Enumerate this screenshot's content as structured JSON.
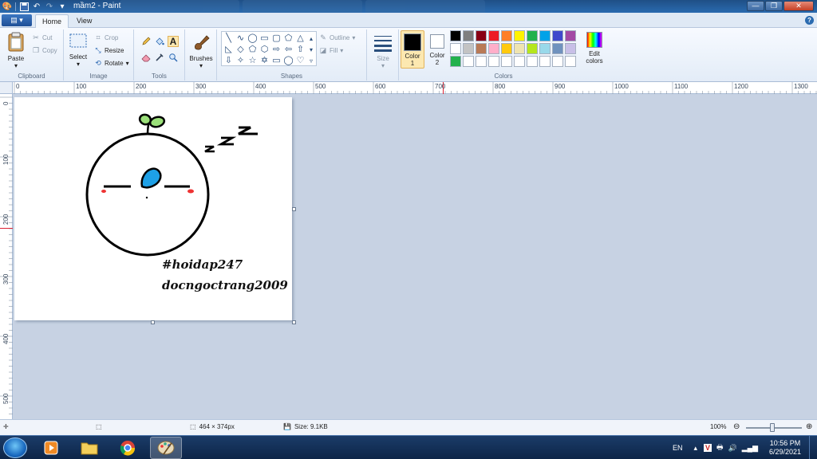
{
  "window": {
    "title": "mầm2 - Paint",
    "minimize": "—",
    "maximize": "❐",
    "close": "✕"
  },
  "ribbon_tabs": {
    "file": "▤ ▾",
    "home": "Home",
    "view": "View",
    "help": "?"
  },
  "clipboard": {
    "paste": "Paste",
    "cut": "Cut",
    "copy": "Copy",
    "label": "Clipboard"
  },
  "image": {
    "select": "Select",
    "crop": "Crop",
    "resize": "Resize",
    "rotate": "Rotate",
    "label": "Image"
  },
  "tools": {
    "label": "Tools"
  },
  "brushes": {
    "label": "Brushes"
  },
  "shapes": {
    "outline": "Outline",
    "fill": "Fill",
    "label": "Shapes"
  },
  "size": {
    "label": "Size"
  },
  "colors": {
    "color1_label": "Color 1",
    "color2_label": "Color 2",
    "color1_value": "#000000",
    "color2_value": "#ffffff",
    "edit_colors": "Edit colors",
    "label": "Colors",
    "palette": [
      "#000000",
      "#7f7f7f",
      "#880015",
      "#ed1c24",
      "#ff7f27",
      "#fff200",
      "#22b14c",
      "#00a2e8",
      "#3f48cc",
      "#a349a4",
      "#ffffff",
      "#c3c3c3",
      "#b97a57",
      "#ffaec9",
      "#ffc90e",
      "#efe4b0",
      "#b5e61d",
      "#99d9ea",
      "#7092be",
      "#c8bfe7",
      "#22b14c",
      "#ffffff",
      "#ffffff",
      "#ffffff",
      "#ffffff",
      "#ffffff",
      "#ffffff",
      "#ffffff",
      "#ffffff",
      "#ffffff"
    ]
  },
  "ruler": {
    "h_labels": [
      "0",
      "100",
      "200",
      "300",
      "400",
      "500",
      "600",
      "700",
      "800",
      "900",
      "1000",
      "1100",
      "1200",
      "1300"
    ],
    "v_labels": [
      "0",
      "100",
      "200",
      "300",
      "400",
      "500"
    ]
  },
  "drawing": {
    "text_line1": "#hoidap247",
    "text_line2": "docngoctrang2009",
    "z_big": "Z",
    "z_mid": "Z",
    "z_small": "Z"
  },
  "status": {
    "dimensions": "464 × 374px",
    "size": "Size: 9.1KB",
    "zoom": "100%"
  },
  "taskbar": {
    "lang": "EN",
    "time": "10:56 PM",
    "date": "6/29/2021"
  }
}
